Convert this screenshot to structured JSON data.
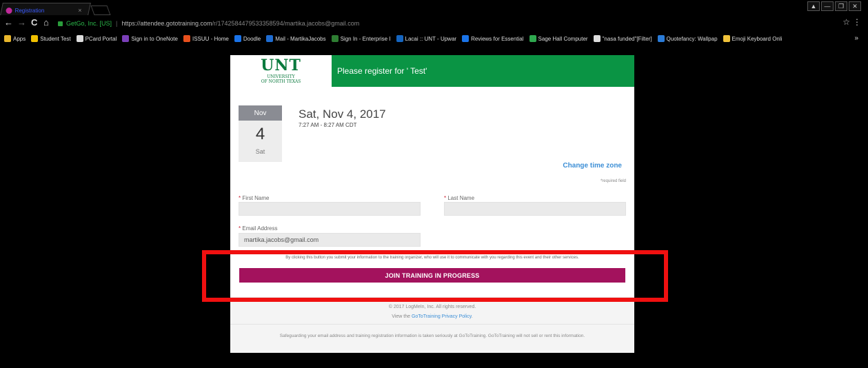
{
  "browser": {
    "tab_title": "Registration",
    "tab_close": "×",
    "window_controls": [
      "▲",
      "—",
      "❐",
      "✕"
    ],
    "nav": {
      "back": "←",
      "forward": "→",
      "reload": "C",
      "home": "⌂"
    },
    "security_label": "GetGo, Inc. [US]",
    "separator": "|",
    "url_host": "https://attendee.gototraining.com",
    "url_path": "/r/1742584479533358594/martika.jacobs@gmail.com",
    "star": "☆",
    "menu": "⋮"
  },
  "bookmarks": {
    "items": [
      {
        "label": "Apps",
        "color": "#e8b62c"
      },
      {
        "label": "Student Test",
        "color": "#f0c000"
      },
      {
        "label": "PCard Portal",
        "color": "#dddddd"
      },
      {
        "label": "Sign in to OneNote",
        "color": "#7a3fb8"
      },
      {
        "label": "ISSUU - Home",
        "color": "#e8501d"
      },
      {
        "label": "Doodle",
        "color": "#1a73e8"
      },
      {
        "label": "Mail - MartikaJacobs",
        "color": "#1e6cd1"
      },
      {
        "label": "Sign In - Enterprise I",
        "color": "#2e7d32"
      },
      {
        "label": "Lacai :: UNT - Upwar",
        "color": "#1565c0"
      },
      {
        "label": "Reviews for Essential",
        "color": "#1a73e8"
      },
      {
        "label": "Sage Hall Computer",
        "color": "#2fa84f"
      },
      {
        "label": "\"nasa funded\"[Filter]",
        "color": "#dddddd"
      },
      {
        "label": "Quotefancy: Wallpap",
        "color": "#2a7bd8"
      },
      {
        "label": "Emoji Keyboard Onli",
        "color": "#f0c23a"
      }
    ],
    "more": "»"
  },
  "page": {
    "logo": {
      "mark": "UNT",
      "sub1": "UNIVERSITY",
      "sub2": "OF NORTH TEXAS"
    },
    "banner_text": "Please register for ' Test'",
    "date": {
      "month": "Nov",
      "day": "4",
      "weekday": "Sat",
      "full": "Sat, Nov 4, 2017",
      "time": "7:27 AM - 8:27 AM CDT"
    },
    "change_timezone": "Change time zone",
    "required_note": "*required field",
    "form": {
      "first_name_label": "First Name",
      "last_name_label": "Last Name",
      "email_label": "Email Address",
      "required_mark": "*",
      "first_name_value": "",
      "last_name_value": "",
      "email_value": "martika.jacobs@gmail.com"
    },
    "disclaimer": "By clicking this button you submit your information to the training organizer, who will use it to communicate with you regarding this event and their other services.",
    "join_button": "JOIN TRAINING IN PROGRESS",
    "footer": {
      "copyright": "© 2017 LogMeIn, Inc. All rights reserved.",
      "privacy_prefix": "View the ",
      "privacy_link": "GoToTraining Privacy Policy",
      "privacy_suffix": ".",
      "safeguard": "Safeguarding your email address and training registration information is taken seriously at GoToTraining. GoToTraining will not sell or rent this information."
    }
  },
  "colors": {
    "banner_green": "#0a9444",
    "button_magenta": "#a3125d",
    "link_blue": "#3d8fd6",
    "highlight_red": "#f01010"
  }
}
